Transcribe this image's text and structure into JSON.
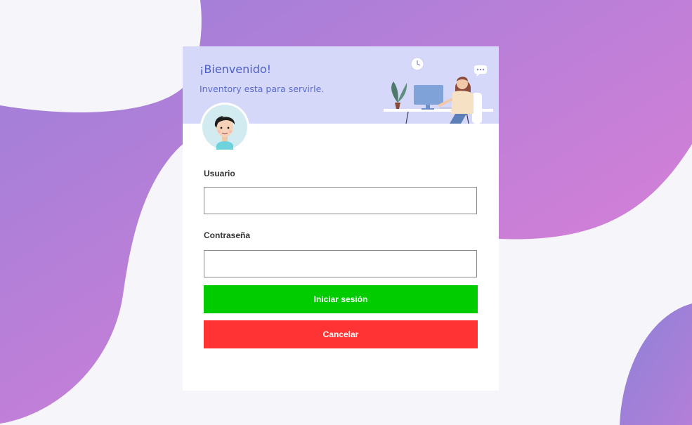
{
  "header": {
    "title": "¡Bienvenido!",
    "subtitle": "Inventory esta para servirle."
  },
  "form": {
    "username_label": "Usuario",
    "username_value": "",
    "password_label": "Contraseña",
    "password_value": "",
    "login_button": "Iniciar sesión",
    "cancel_button": "Cancelar"
  },
  "colors": {
    "header_background": "#d6d8fa",
    "title_text": "#4a5fc9",
    "login_button": "#00cc00",
    "cancel_button": "#ff3333",
    "background_blob_start": "#9b7fd9",
    "background_blob_end": "#e57fd6"
  },
  "icons": {
    "avatar": "user-avatar-icon",
    "illustration": "office-worker-illustration"
  }
}
